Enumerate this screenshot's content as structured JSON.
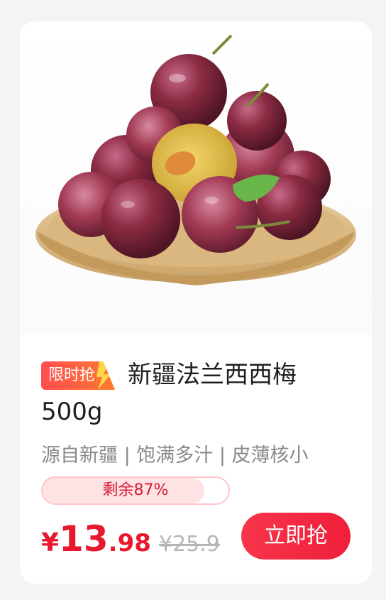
{
  "product": {
    "badge": "限时抢",
    "title": "新疆法兰西西梅 500g",
    "features": "源自新疆 | 饱满多汁 | 皮薄核小",
    "stock_label": "剩余87%",
    "stock_fraction": 0.87,
    "price": {
      "currency": "¥",
      "integer": "13",
      "decimal": ".98",
      "original": "¥25.9"
    },
    "buy_label": "立即抢"
  },
  "colors": {
    "accent": "#e8182f",
    "badge_start": "#ff4d4f",
    "badge_end": "#ff7a2e",
    "stock_track": "#ffc3c7",
    "stock_fill": "#ffe2e4"
  },
  "image": {
    "subject": "plums-in-wooden-bowl"
  }
}
